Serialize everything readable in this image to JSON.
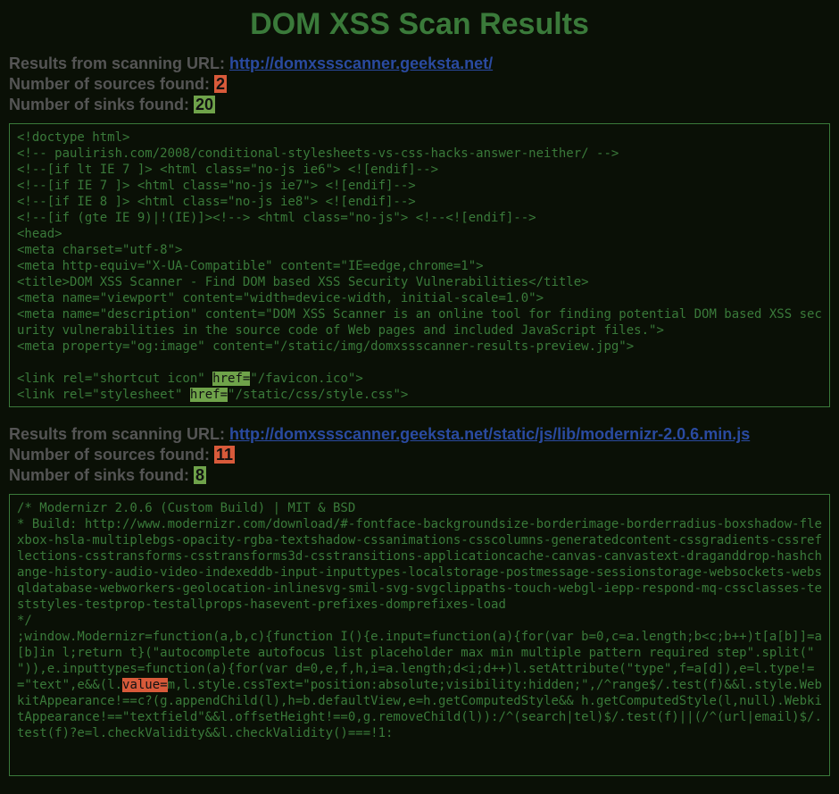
{
  "title": "DOM XSS Scan Results",
  "labels": {
    "url_prefix": "Results from scanning URL: ",
    "sources_prefix": "Number of sources found: ",
    "sinks_prefix": "Number of sinks found: "
  },
  "sections": [
    {
      "url": "http://domxssscanner.geeksta.net/",
      "sources": "2",
      "sinks": "20",
      "code_pre": "<!doctype html>\n<!-- paulirish.com/2008/conditional-stylesheets-vs-css-hacks-answer-neither/ -->\n<!--[if lt IE 7 ]> <html class=\"no-js ie6\"> <![endif]-->\n<!--[if IE 7 ]> <html class=\"no-js ie7\"> <![endif]-->\n<!--[if IE 8 ]> <html class=\"no-js ie8\"> <![endif]-->\n<!--[if (gte IE 9)|!(IE)]><!--> <html class=\"no-js\"> <!--<![endif]-->\n<head>\n<meta charset=\"utf-8\">\n<meta http-equiv=\"X-UA-Compatible\" content=\"IE=edge,chrome=1\">\n<title>DOM XSS Scanner - Find DOM based XSS Security Vulnerabilities</title>\n<meta name=\"viewport\" content=\"width=device-width, initial-scale=1.0\">\n<meta name=\"description\" content=\"DOM XSS Scanner is an online tool for finding potential DOM based XSS security vulnerabilities in the source code of Web pages and included JavaScript files.\">\n<meta property=\"og:image\" content=\"/static/img/domxssscanner-results-preview.jpg\">\n\n<link rel=\"shortcut icon\" ",
      "code_hl1": "href=",
      "code_mid": "\"/favicon.ico\">\n<link rel=\"stylesheet\" ",
      "code_hl2": "href=",
      "code_post": "\"/static/css/style.css\">"
    },
    {
      "url": "http://domxssscanner.geeksta.net/static/js/lib/modernizr-2.0.6.min.js",
      "sources": "11",
      "sinks": "8",
      "code_pre": "/* Modernizr 2.0.6 (Custom Build) | MIT & BSD\n* Build: http://www.modernizr.com/download/#-fontface-backgroundsize-borderimage-borderradius-boxshadow-flexbox-hsla-multiplebgs-opacity-rgba-textshadow-cssanimations-csscolumns-generatedcontent-cssgradients-cssreflections-csstransforms-csstransforms3d-csstransitions-applicationcache-canvas-canvastext-draganddrop-hashchange-history-audio-video-indexeddb-input-inputtypes-localstorage-postmessage-sessionstorage-websockets-websqldatabase-webworkers-geolocation-inlinesvg-smil-svg-svgclippaths-touch-webgl-iepp-respond-mq-cssclasses-teststyles-testprop-testallprops-hasevent-prefixes-domprefixes-load\n*/\n;window.Modernizr=function(a,b,c){function I(){e.input=function(a){for(var b=0,c=a.length;b<c;b++)t[a[b]]=a[b]in l;return t}(\"autocomplete autofocus list placeholder max min multiple pattern required step\".split(\" \")),e.inputtypes=function(a){for(var d=0,e,f,h,i=a.length;d<i;d++)l.setAttribute(\"type\",f=a[d]),e=l.type!==\"text\",e&&(l.",
      "code_hl1": "value=",
      "code_mid": "m,l.style.cssText=\"position:absolute;visibility:hidden;\",/^range$/.test(f)&&l.style.WebkitAppearance!==c?(g.appendChild(l),h=b.defaultView,e=h.getComputedStyle&& h.getComputedStyle(l,null).WebkitAppearance!==\"textfield\"&&l.offsetHeight!==0,g.removeChild(l)):/^(search|tel)$/.test(f)||(/^(url|email)$/.test(f)?e=l.checkValidity&&l.checkValidity()===!1:",
      "code_hl2": "",
      "code_post": ""
    }
  ]
}
